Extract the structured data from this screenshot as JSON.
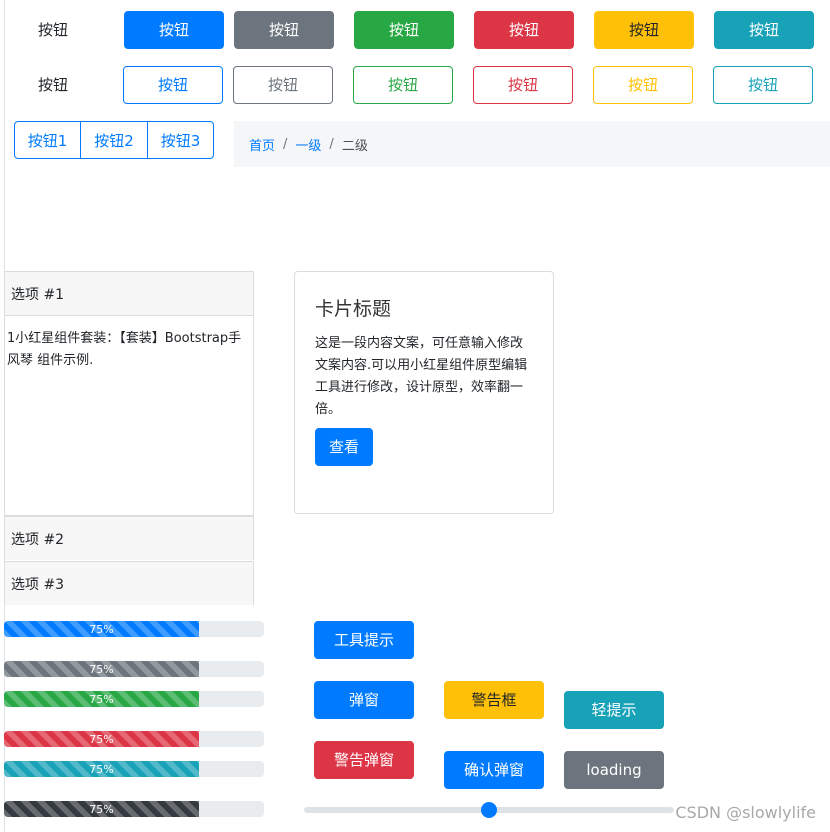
{
  "row1": {
    "plain_label": "按钮",
    "buttons": [
      {
        "label": "按钮",
        "variant": "primary"
      },
      {
        "label": "按钮",
        "variant": "secondary"
      },
      {
        "label": "按钮",
        "variant": "success"
      },
      {
        "label": "按钮",
        "variant": "danger"
      },
      {
        "label": "按钮",
        "variant": "warning"
      },
      {
        "label": "按钮",
        "variant": "info"
      }
    ]
  },
  "row2": {
    "plain_label": "按钮",
    "buttons": [
      {
        "label": "按钮",
        "variant": "outline-primary"
      },
      {
        "label": "按钮",
        "variant": "outline-secondary"
      },
      {
        "label": "按钮",
        "variant": "outline-success"
      },
      {
        "label": "按钮",
        "variant": "outline-danger"
      },
      {
        "label": "按钮",
        "variant": "outline-warning"
      },
      {
        "label": "按钮",
        "variant": "outline-info"
      }
    ]
  },
  "button_group": [
    "按钮1",
    "按钮2",
    "按钮3"
  ],
  "breadcrumb": {
    "items": [
      "首页",
      "一级"
    ],
    "separator": "/",
    "active": "二级"
  },
  "accordion": [
    {
      "title": "选项 #1",
      "body": "1小红星组件套装：【套装】Bootstrap手风琴 组件示例."
    },
    {
      "title": "选项 #2"
    },
    {
      "title": "选项 #3"
    }
  ],
  "card": {
    "title": "卡片标题",
    "text": "这是一段内容文案，可任意输入修改文案内容.可以用小红星组件原型编辑工具进行修改，设计原型，效率翻一倍。",
    "button": "查看"
  },
  "progress_bars": [
    {
      "label": "75%",
      "value": 0.75,
      "color": "#007bff"
    },
    {
      "label": "75%",
      "value": 0.75,
      "color": "#6c757d"
    },
    {
      "label": "75%",
      "value": 0.75,
      "color": "#28a745"
    },
    {
      "label": "75%",
      "value": 0.75,
      "color": "#dc3545"
    },
    {
      "label": "75%",
      "value": 0.75,
      "color": "#17a2b8"
    },
    {
      "label": "75%",
      "value": 0.75,
      "color": "#343a40"
    }
  ],
  "action_buttons": {
    "tooltip": "工具提示",
    "modal": "弹窗",
    "alert": "警告框",
    "toast": "轻提示",
    "alert_modal": "警告弹窗",
    "confirm_modal": "确认弹窗",
    "loading": "loading"
  },
  "slider": {
    "value": 0.5
  },
  "watermark": "CSDN @slowlylife",
  "colors": {
    "primary": "#007bff",
    "secondary": "#6c757d",
    "success": "#28a745",
    "danger": "#dc3545",
    "warning": "#ffc107",
    "info": "#17a2b8",
    "dark": "#343a40"
  }
}
